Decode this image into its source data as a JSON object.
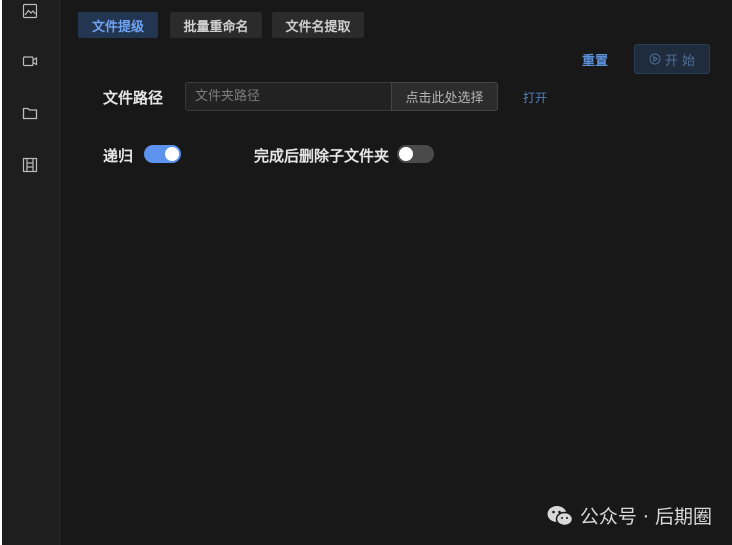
{
  "sidebar": {
    "items": [
      {
        "icon": "image-icon"
      },
      {
        "icon": "video-icon"
      },
      {
        "icon": "folder-icon"
      },
      {
        "icon": "film-icon"
      }
    ]
  },
  "tabs": [
    {
      "label": "文件提级",
      "active": true
    },
    {
      "label": "批量重命名",
      "active": false
    },
    {
      "label": "文件名提取",
      "active": false
    }
  ],
  "toolbar": {
    "reset_label": "重置",
    "start_label": "开 始"
  },
  "form": {
    "path_label": "文件路径",
    "path_value": "",
    "path_placeholder": "文件夹路径",
    "choose_label": "点击此处选择",
    "open_label": "打开",
    "recursive_label": "递归",
    "recursive_on": true,
    "delete_label": "完成后删除子文件夹",
    "delete_on": false
  },
  "watermark": {
    "text": "公众号 · 后期圈"
  },
  "colors": {
    "accent": "#5d93ef",
    "background": "#181818",
    "sidebar": "#1e1e1e",
    "active_tab_bg": "#223551"
  }
}
